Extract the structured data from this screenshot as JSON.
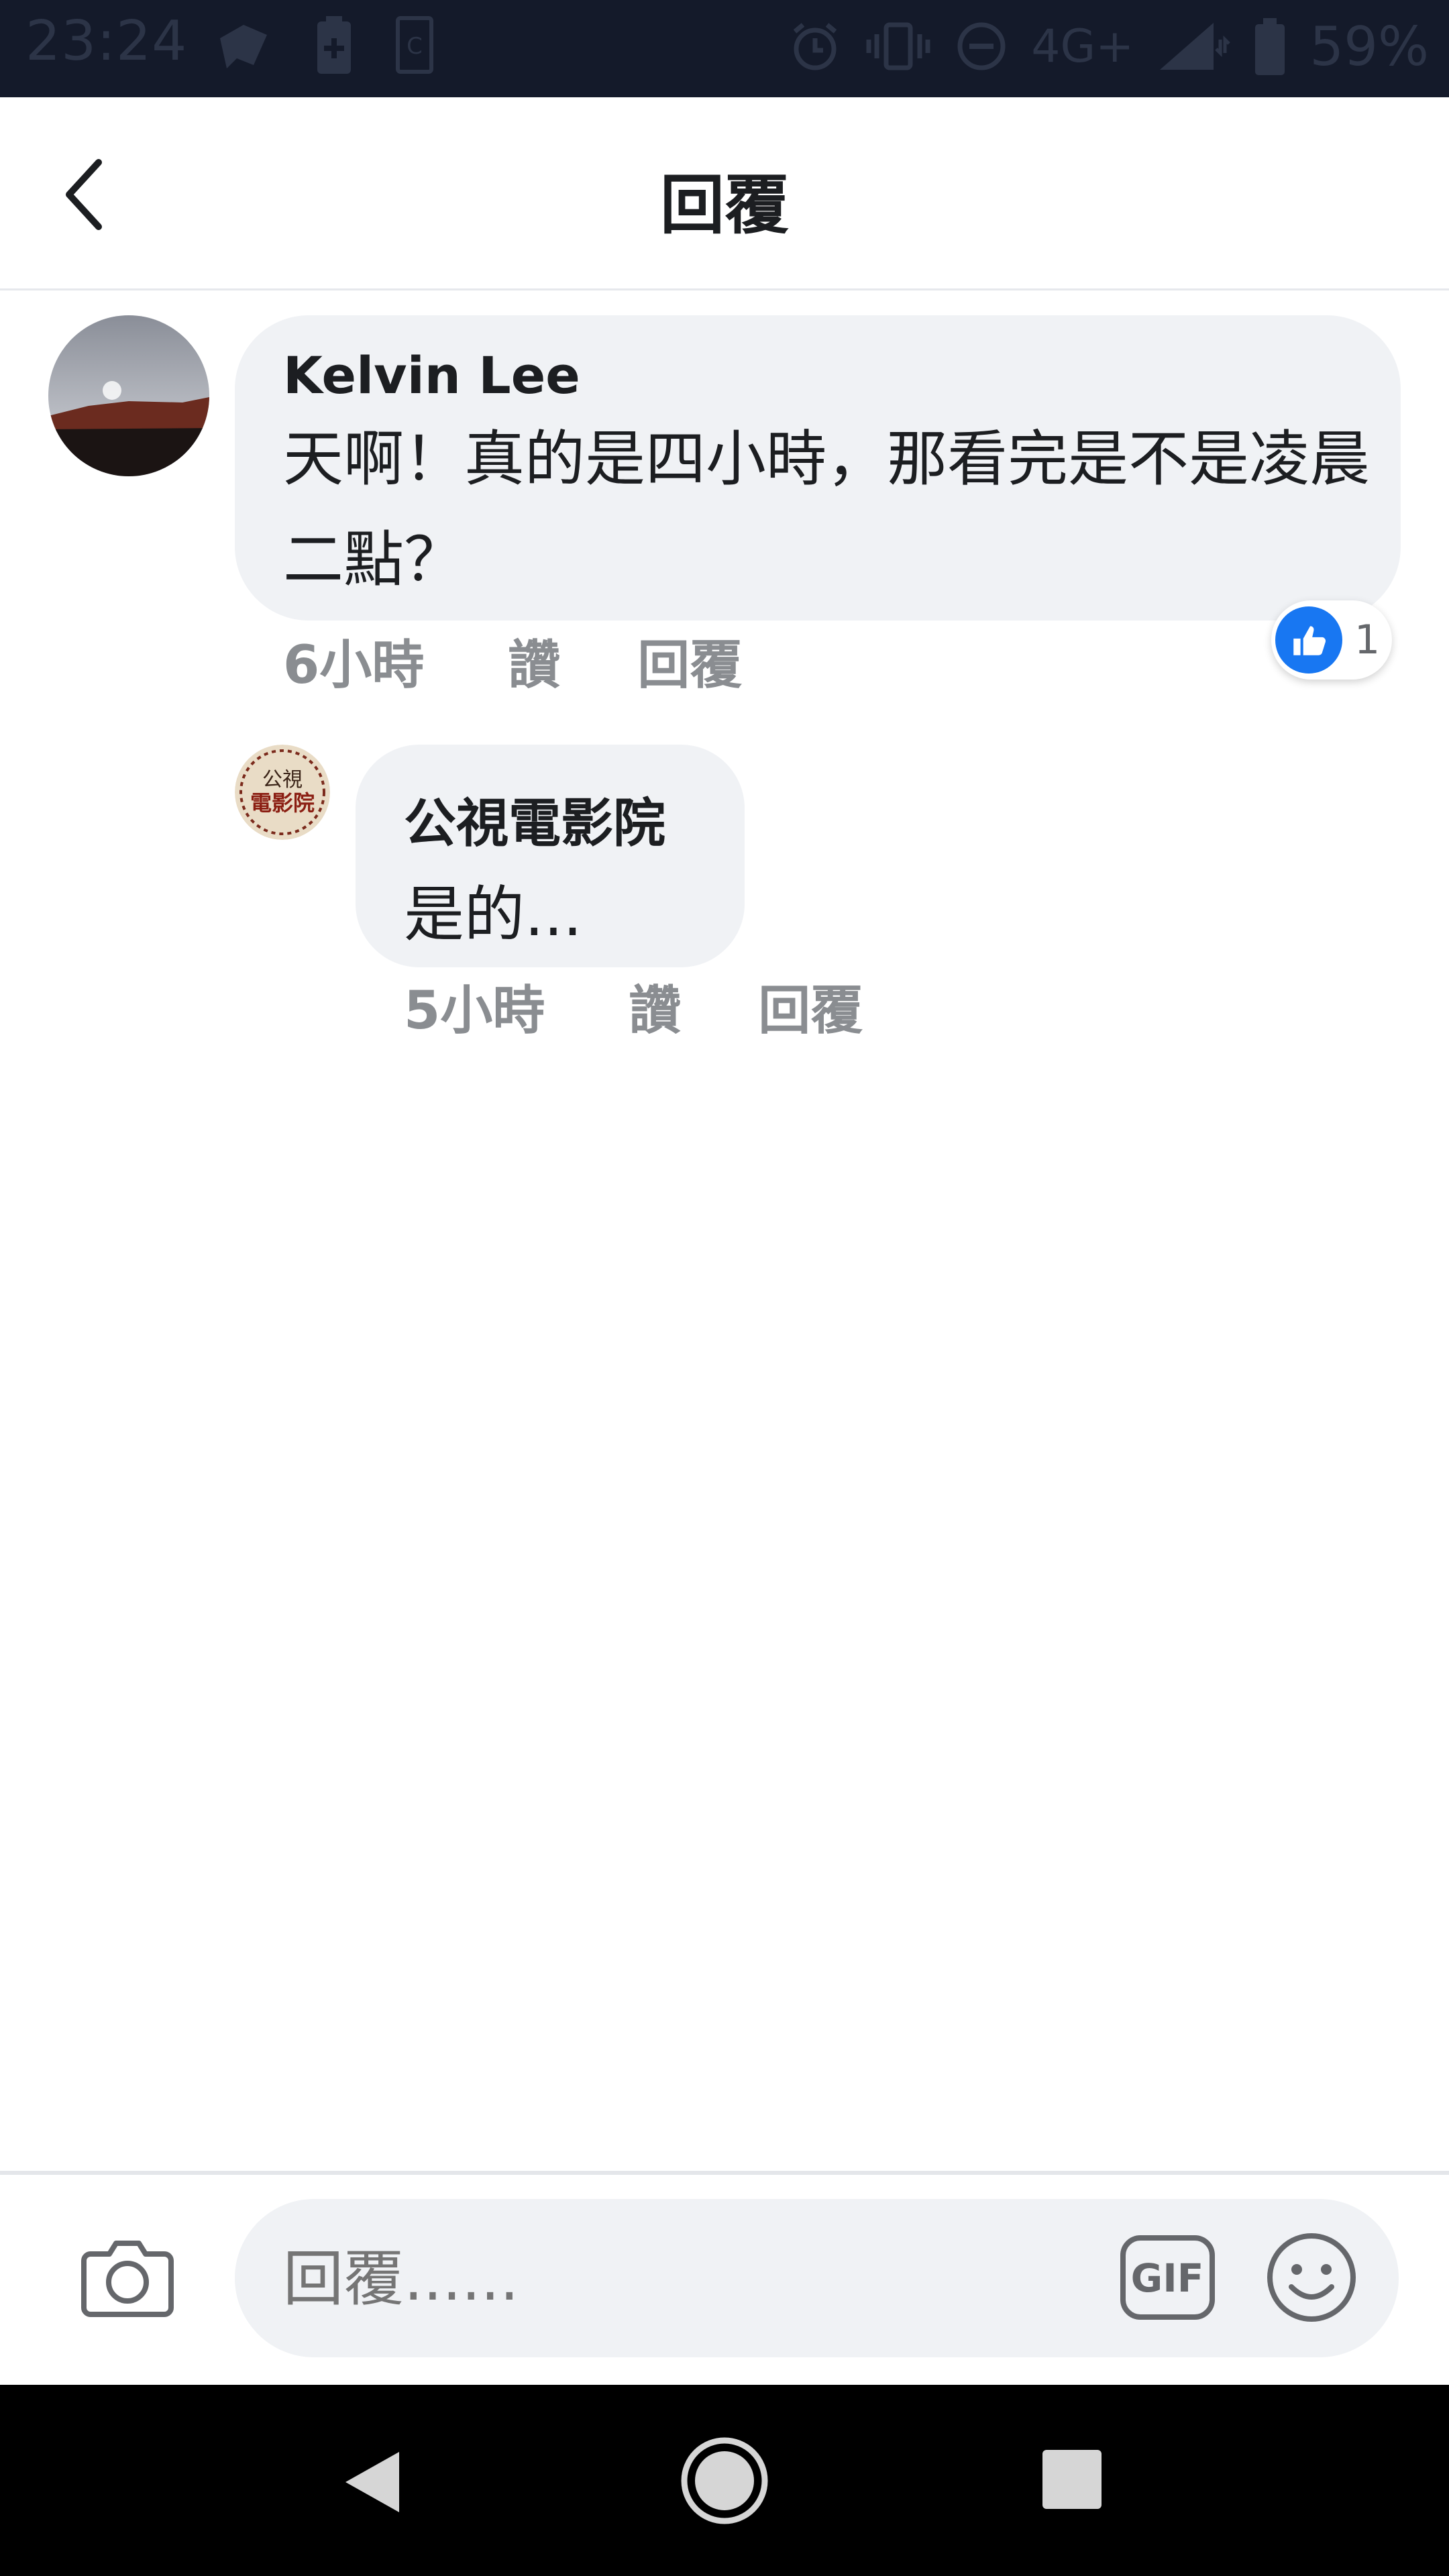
{
  "status_bar": {
    "time": "23:24",
    "network": "4G+",
    "battery": "59%",
    "icons": [
      "notification-app-icon",
      "battery-saver-icon",
      "c-icon",
      "alarm-icon",
      "vibrate-icon",
      "do-not-disturb-icon",
      "signal-icon",
      "battery-icon"
    ]
  },
  "header": {
    "title": "回覆",
    "back_icon": "chevron-left-icon"
  },
  "comment": {
    "author": "Kelvin Lee",
    "text": "天啊！真的是四小時，那看完是不是凌晨二點？",
    "time": "6小時",
    "like_label": "讚",
    "reply_label": "回覆",
    "reaction_count": "1",
    "reaction_icon": "thumbs-up-icon"
  },
  "reply": {
    "author": "公視電影院",
    "text": "是的...",
    "time": "5小時",
    "like_label": "讚",
    "reply_label": "回覆",
    "avatar_text": "公視電影院"
  },
  "composer": {
    "placeholder": "回覆......",
    "gif_label": "GIF",
    "camera_icon": "camera-icon",
    "emoji_icon": "smiley-icon"
  },
  "nav_bar": {
    "icons": [
      "nav-back-icon",
      "nav-home-icon",
      "nav-recents-icon"
    ]
  },
  "colors": {
    "accent_blue": "#1877f2",
    "bubble_bg": "#f0f2f5",
    "meta_gray": "#8a8d91",
    "status_bar_bg": "#141a2a"
  }
}
